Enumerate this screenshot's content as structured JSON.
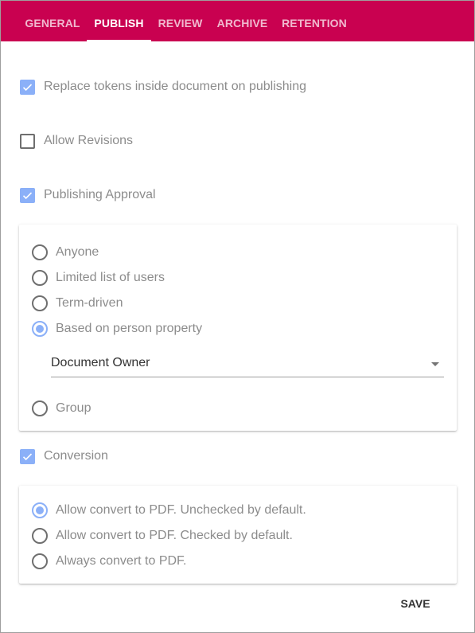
{
  "tabs": [
    {
      "label": "GENERAL",
      "active": false
    },
    {
      "label": "PUBLISH",
      "active": true
    },
    {
      "label": "REVIEW",
      "active": false
    },
    {
      "label": "ARCHIVE",
      "active": false
    },
    {
      "label": "RETENTION",
      "active": false
    }
  ],
  "options": {
    "replace_tokens": {
      "label": "Replace tokens inside document on publishing",
      "checked": true
    },
    "allow_revisions": {
      "label": "Allow Revisions",
      "checked": false
    },
    "publishing_approval": {
      "label": "Publishing Approval",
      "checked": true
    },
    "conversion": {
      "label": "Conversion",
      "checked": true
    }
  },
  "approval": {
    "radios": [
      {
        "label": "Anyone",
        "selected": false
      },
      {
        "label": "Limited list of users",
        "selected": false
      },
      {
        "label": "Term-driven",
        "selected": false
      },
      {
        "label": "Based on person property",
        "selected": true
      },
      {
        "label": "Group",
        "selected": false
      }
    ],
    "person_property": {
      "value": "Document Owner"
    }
  },
  "conversion_options": {
    "radios": [
      {
        "label": "Allow convert to PDF. Unchecked by default.",
        "selected": true
      },
      {
        "label": "Allow convert to PDF. Checked by default.",
        "selected": false
      },
      {
        "label": "Always convert to PDF.",
        "selected": false
      }
    ]
  },
  "actions": {
    "save_label": "SAVE"
  },
  "colors": {
    "tab_bar": "#c90150",
    "accent": "#8bb0f8",
    "label_text": "#8c8c8c"
  }
}
